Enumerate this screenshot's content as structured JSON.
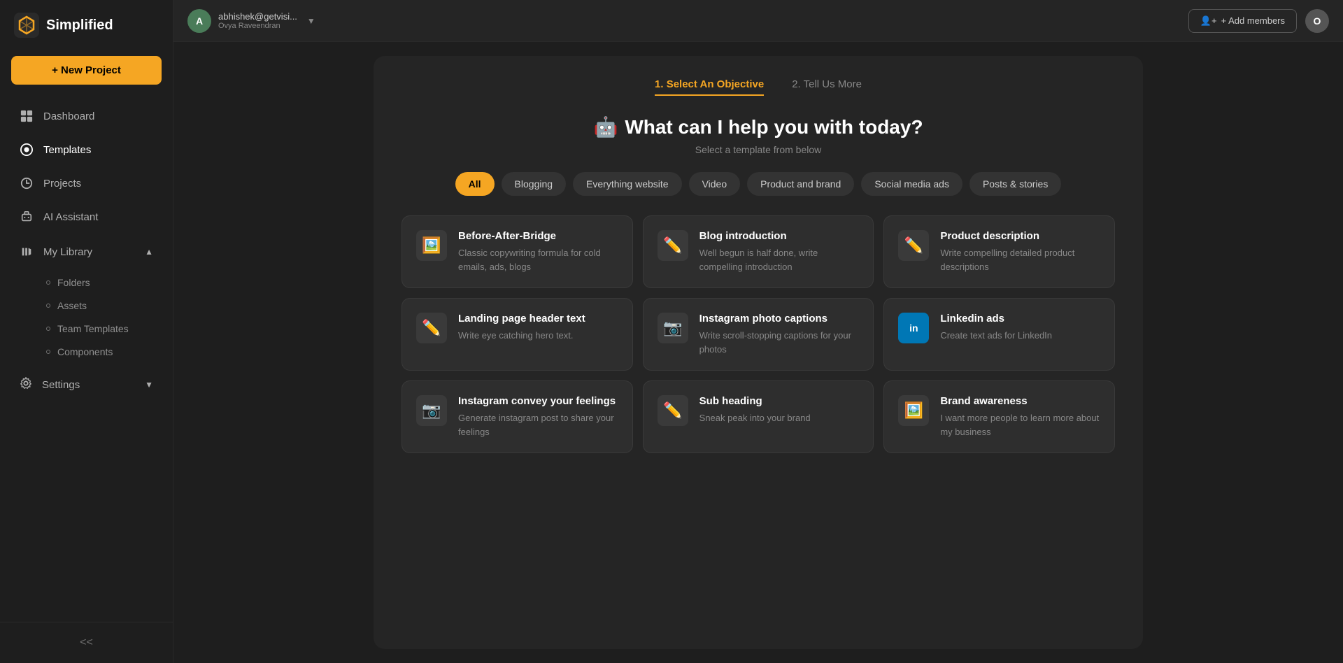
{
  "app": {
    "name": "Simplified",
    "logo_alt": "Simplified logo"
  },
  "topbar": {
    "user_email": "abhishek@getvisi...",
    "user_name": "Ovya Raveendran",
    "user_initial": "A",
    "add_members_label": "+ Add members",
    "user_circle_label": "O"
  },
  "sidebar": {
    "new_project_label": "+ New Project",
    "nav_items": [
      {
        "id": "dashboard",
        "label": "Dashboard"
      },
      {
        "id": "templates",
        "label": "Templates"
      },
      {
        "id": "projects",
        "label": "Projects"
      },
      {
        "id": "ai-assistant",
        "label": "AI Assistant"
      }
    ],
    "my_library_label": "My Library",
    "my_library_sub": [
      {
        "id": "folders",
        "label": "Folders"
      },
      {
        "id": "assets",
        "label": "Assets"
      },
      {
        "id": "team-templates",
        "label": "Team Templates"
      },
      {
        "id": "components",
        "label": "Components"
      }
    ],
    "settings_label": "Settings",
    "collapse_label": "<<"
  },
  "wizard": {
    "step1_label": "1. Select An Objective",
    "step2_label": "2. Tell Us More",
    "heading": "What can I help you with today?",
    "subtext": "Select a template from below",
    "robot_icon": "🤖"
  },
  "filters": [
    {
      "id": "all",
      "label": "All",
      "active": true
    },
    {
      "id": "blogging",
      "label": "Blogging",
      "active": false
    },
    {
      "id": "everything-website",
      "label": "Everything website",
      "active": false
    },
    {
      "id": "video",
      "label": "Video",
      "active": false
    },
    {
      "id": "product-and-brand",
      "label": "Product and brand",
      "active": false
    },
    {
      "id": "social-media-ads",
      "label": "Social media ads",
      "active": false
    },
    {
      "id": "posts-stories",
      "label": "Posts & stories",
      "active": false
    }
  ],
  "templates": [
    {
      "id": "before-after-bridge",
      "icon": "🖼️",
      "title": "Before-After-Bridge",
      "desc": "Classic copywriting formula for cold emails, ads, blogs"
    },
    {
      "id": "blog-introduction",
      "icon": "✏️",
      "title": "Blog introduction",
      "desc": "Well begun is half done, write compelling introduction"
    },
    {
      "id": "product-description",
      "icon": "✏️",
      "title": "Product description",
      "desc": "Write compelling detailed product descriptions"
    },
    {
      "id": "landing-page-header",
      "icon": "✏️",
      "title": "Landing page header text",
      "desc": "Write eye catching hero text."
    },
    {
      "id": "instagram-photo-captions",
      "icon": "📷",
      "title": "Instagram photo captions",
      "desc": "Write scroll-stopping captions for your photos"
    },
    {
      "id": "linkedin-ads",
      "icon": "in",
      "title": "Linkedin ads",
      "desc": "Create text ads for LinkedIn"
    },
    {
      "id": "instagram-convey-feelings",
      "icon": "📷",
      "title": "Instagram convey your feelings",
      "desc": "Generate instagram post to share your feelings"
    },
    {
      "id": "sub-heading",
      "icon": "✏️",
      "title": "Sub heading",
      "desc": "Sneak peak into your brand"
    },
    {
      "id": "brand-awareness",
      "icon": "🖼️",
      "title": "Brand awareness",
      "desc": "I want more people to learn more about my business"
    }
  ]
}
